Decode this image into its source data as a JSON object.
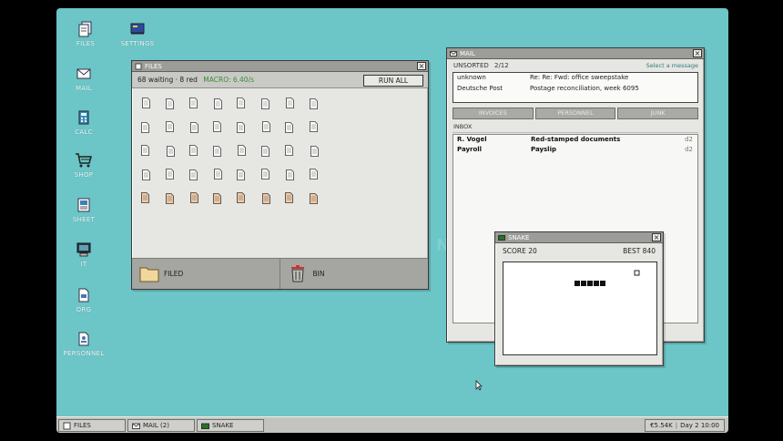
{
  "desktop": {
    "icons": [
      {
        "label": "FILES",
        "icon": "files-icon"
      },
      {
        "label": "SETTINGS",
        "icon": "settings-icon"
      },
      {
        "label": "MAIL",
        "icon": "mail-icon"
      },
      {
        "label": "CALC",
        "icon": "calc-icon"
      },
      {
        "label": "SHOP",
        "icon": "shop-icon"
      },
      {
        "label": "SHEET",
        "icon": "sheet-icon"
      },
      {
        "label": "IT",
        "icon": "computer-icon"
      },
      {
        "label": "ORG",
        "icon": "org-icon"
      },
      {
        "label": "PERSONNEL",
        "icon": "personnel-icon"
      }
    ]
  },
  "files_window": {
    "title": "FILES",
    "status": "68 waiting · 8 red",
    "macro": "MACRO: 6.40/s",
    "run_all": "RUN ALL",
    "filed_label": "FILED",
    "bin_label": "BIN",
    "docs": {
      "white_rows": 4,
      "orange_rows": 1,
      "columns": 8
    }
  },
  "mail_window": {
    "title": "MAIL",
    "unsorted_label": "UNSORTED",
    "unsorted_count": "2/12",
    "select_hint": "Select a message",
    "unsorted": [
      {
        "from": "unknown",
        "subject": "Re: Re: Fwd: office sweepstake"
      },
      {
        "from": "Deutsche Post",
        "subject": "Postage reconciliation, week 6095"
      }
    ],
    "tabs": [
      "INVOICES",
      "PERSONNEL",
      "JUNK"
    ],
    "inbox_label": "INBOX",
    "inbox": [
      {
        "from": "R. Vogel",
        "subject": "Red-stamped documents",
        "day": "d2"
      },
      {
        "from": "Payroll",
        "subject": "Payslip",
        "day": "d2"
      }
    ]
  },
  "snake_window": {
    "title": "SNAKE",
    "score": "SCORE 20",
    "best": "BEST 840",
    "snake_length": 5
  },
  "taskbar": {
    "items": [
      {
        "label": "FILES",
        "icon": "files-icon"
      },
      {
        "label": "MAIL (2)",
        "icon": "mail-icon"
      },
      {
        "label": "SNAKE",
        "icon": "snake-icon"
      }
    ],
    "money": "€5.54K",
    "day_time": "Day 2 10:00"
  },
  "colors": {
    "desktop": "#6cc5c7",
    "window": "#e6e6e2",
    "titlebar": "#9c9c98",
    "macro": "#3b8e34",
    "red_doc": "#f0c9a3"
  }
}
